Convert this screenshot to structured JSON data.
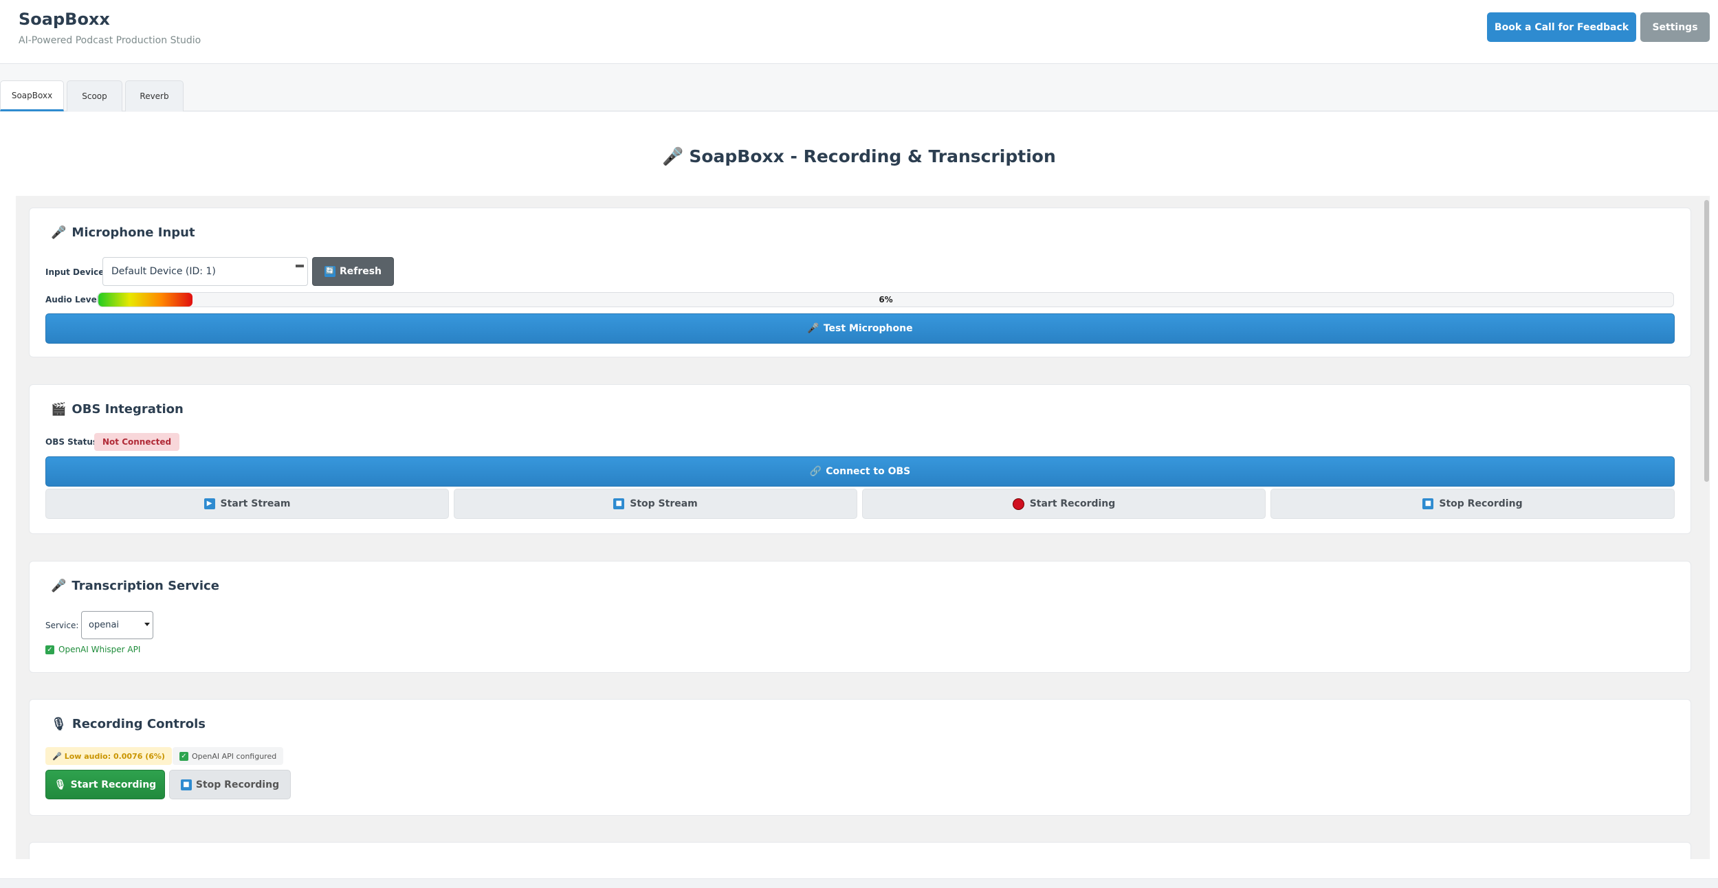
{
  "header": {
    "title": "SoapBoxx",
    "subtitle": "AI-Powered Podcast Production Studio",
    "feedback_label": "Book a Call for Feedback",
    "settings_label": "Settings"
  },
  "tabs": [
    {
      "label": "SoapBoxx",
      "active": true
    },
    {
      "label": "Scoop",
      "active": false
    },
    {
      "label": "Reverb",
      "active": false
    }
  ],
  "main": {
    "title_icon": "🎤",
    "title": "SoapBoxx - Recording & Transcription"
  },
  "microphone": {
    "icon": "🎤",
    "title": "Microphone Input",
    "device_label": "Input Device:",
    "device_value": "Default Device (ID: 1)",
    "refresh_label": "Refresh",
    "refresh_icon": "🔄",
    "level_label": "Audio Level:",
    "level_percent": 6,
    "level_text": "6%",
    "test_icon": "🎤",
    "test_label": "Test Microphone"
  },
  "obs": {
    "icon": "🎬",
    "title": "OBS Integration",
    "status_label": "OBS Status:",
    "status_value": "Not Connected",
    "connect_icon": "🔗",
    "connect_label": "Connect to OBS",
    "start_stream_icon": "▶",
    "start_stream_label": "Start Stream",
    "stop_stream_icon": "■",
    "stop_stream_label": "Stop Stream",
    "start_recording_label": "Start Recording",
    "stop_recording_icon": "■",
    "stop_recording_label": "Stop Recording"
  },
  "transcription": {
    "icon": "🎤",
    "title": "Transcription Service",
    "service_label": "Service:",
    "service_value": "openai",
    "check_icon": "✓",
    "api_status": "OpenAI Whisper API"
  },
  "recording": {
    "icon": "🎙",
    "title": "Recording Controls",
    "low_audio_icon": "🎤",
    "low_audio_text": "Low audio: 0.0076 (6%)",
    "api_check_icon": "✓",
    "api_configured_text": "OpenAI API configured",
    "start_icon": "🎙",
    "start_label": "Start Recording",
    "stop_icon": "■",
    "stop_label": "Stop Recording"
  },
  "colors": {
    "primary": "#2e8bd0",
    "success": "#28a745",
    "danger_bg": "#f8d7da",
    "warning_bg": "#fff3cd"
  }
}
